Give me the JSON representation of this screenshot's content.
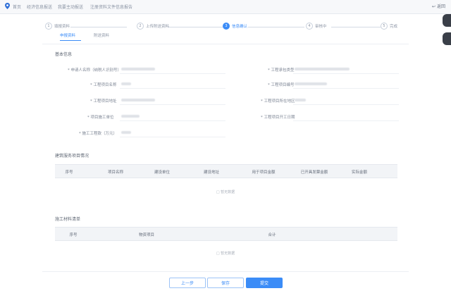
{
  "topbar": {
    "breadcrumbs": [
      "首页",
      "经济信息报送",
      "我要主动报送",
      "注册资料文件信息报告"
    ],
    "back_label": "返回"
  },
  "steps": [
    {
      "num": "1",
      "label": "填报资料"
    },
    {
      "num": "2",
      "label": "上传附送资料"
    },
    {
      "num": "3",
      "label": "信息确认"
    },
    {
      "num": "4",
      "label": "审核中"
    },
    {
      "num": "5",
      "label": "完成"
    }
  ],
  "tabs": [
    "申报资料",
    "附送资料"
  ],
  "basic_info": {
    "title": "基本信息",
    "left_fields": [
      {
        "label": "* 申请人名称（纳税人识别号）",
        "value": ""
      },
      {
        "label": "* 工程项目名称",
        "value": ""
      },
      {
        "label": "* 工程项目地址",
        "value": ""
      },
      {
        "label": "* 项目施工单位",
        "value": ""
      },
      {
        "label": "* 施工工程款（万元）",
        "value": ""
      }
    ],
    "right_fields": [
      {
        "label": "* 工程承包类型",
        "value": ""
      },
      {
        "label": "* 工程项目编号",
        "value": ""
      },
      {
        "label": "* 工程项目所在地区",
        "value": ""
      },
      {
        "label": "* 工程项目开工日期",
        "value": ""
      }
    ]
  },
  "table1": {
    "title": "建筑服务项目情况",
    "columns": [
      "序号",
      "项目名称",
      "建设单位",
      "建设地址",
      "用于项目金额",
      "已开具发票金额",
      "实际金额"
    ],
    "empty_text": "暂无数据"
  },
  "table2": {
    "title": "施工材料清单",
    "columns": [
      "序号",
      "物资项目",
      "合计"
    ],
    "empty_text": "暂无数据"
  },
  "buttons": {
    "prev": "上一步",
    "save": "保存",
    "submit": "提交"
  },
  "colors": {
    "accent": "#3b8cf7",
    "header_bg": "#f2f4f7"
  }
}
